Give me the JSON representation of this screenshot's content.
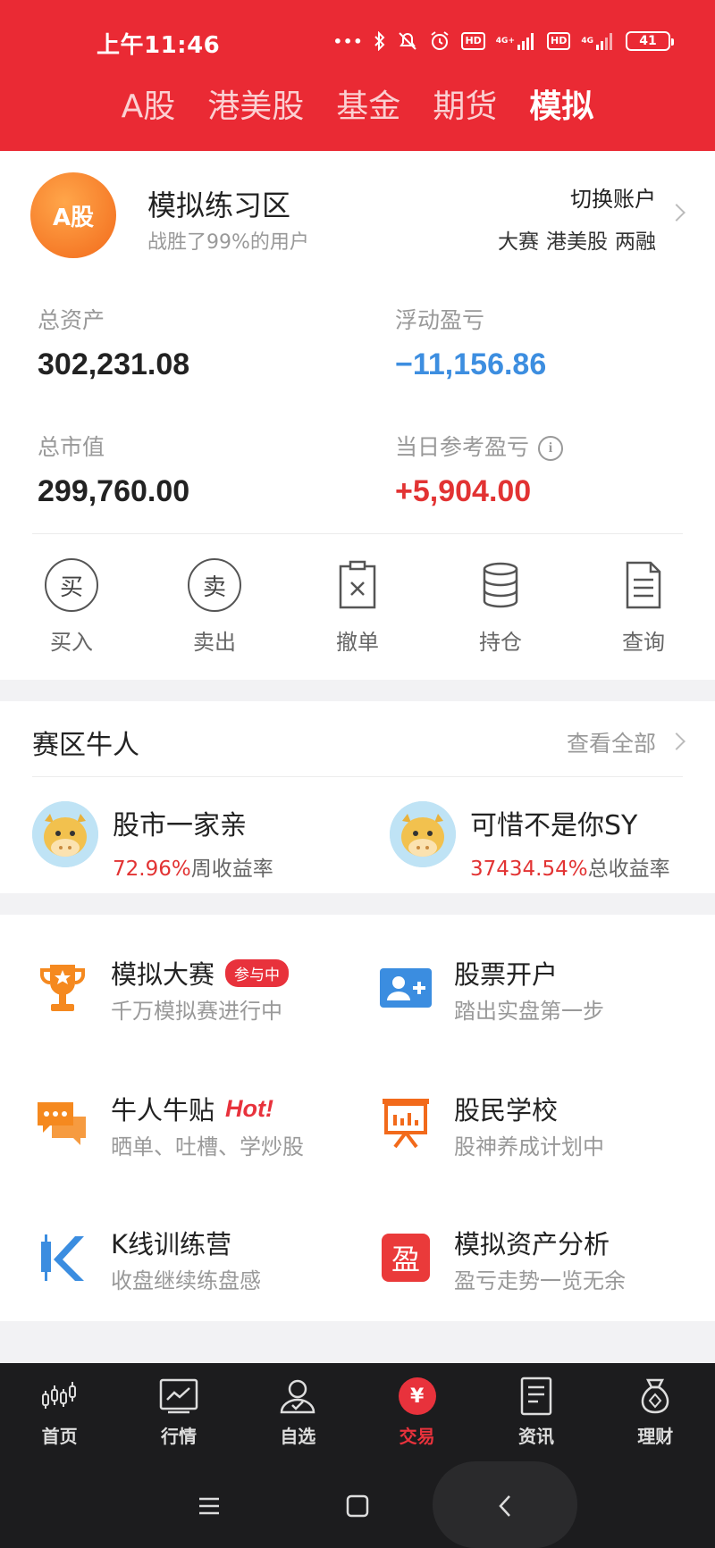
{
  "status_bar": {
    "time": "上午11:46",
    "battery": "41",
    "hd1": "HD",
    "hd2": "HD",
    "net1": "4G+",
    "net2": "4G"
  },
  "top_tabs": [
    {
      "label": "A股",
      "active": false
    },
    {
      "label": "港美股",
      "active": false
    },
    {
      "label": "基金",
      "active": false
    },
    {
      "label": "期货",
      "active": false
    },
    {
      "label": "模拟",
      "active": true
    }
  ],
  "account": {
    "avatar_text": "A股",
    "title": "模拟练习区",
    "subtitle": "战胜了99%的用户",
    "switch_label": "切换账户",
    "links": [
      "大赛",
      "港美股",
      "两融"
    ]
  },
  "metrics": {
    "total_assets_label": "总资产",
    "total_assets": "302,231.08",
    "floating_pl_label": "浮动盈亏",
    "floating_pl": "−11,156.86",
    "market_value_label": "总市值",
    "market_value": "299,760.00",
    "daily_pl_label": "当日参考盈亏",
    "daily_pl": "+5,904.00"
  },
  "actions": [
    {
      "label": "买入",
      "glyph": "买",
      "icon": "buy-icon"
    },
    {
      "label": "卖出",
      "glyph": "卖",
      "icon": "sell-icon"
    },
    {
      "label": "撤单",
      "icon": "cancel-order-icon"
    },
    {
      "label": "持仓",
      "icon": "holdings-icon"
    },
    {
      "label": "查询",
      "icon": "query-icon"
    }
  ],
  "niuren": {
    "title": "赛区牛人",
    "see_all": "查看全部",
    "users": [
      {
        "name": "股市一家亲",
        "pct": "72.96%",
        "suffix": "周收益率"
      },
      {
        "name": "可惜不是你SY",
        "pct": "37434.54%",
        "suffix": "总收益率"
      }
    ]
  },
  "features": [
    {
      "title": "模拟大赛",
      "badge": "参与中",
      "sub": "千万模拟赛进行中",
      "icon": "trophy-icon"
    },
    {
      "title": "股票开户",
      "sub": "踏出实盘第一步",
      "icon": "add-user-icon"
    },
    {
      "title": "牛人牛贴",
      "hot": "Hot!",
      "sub": "晒单、吐槽、学炒股",
      "icon": "chat-bubbles-icon"
    },
    {
      "title": "股民学校",
      "sub": "股神养成计划中",
      "icon": "presentation-board-icon"
    },
    {
      "title": "K线训练营",
      "sub": "收盘继续练盘感",
      "icon": "k-line-icon"
    },
    {
      "title": "模拟资产分析",
      "sub": "盈亏走势一览无余",
      "icon": "profit-analysis-icon",
      "glyph": "盈"
    }
  ],
  "bottom_nav": [
    {
      "label": "首页",
      "icon": "candlestick-home-icon",
      "active": false
    },
    {
      "label": "行情",
      "icon": "market-chart-icon",
      "active": false
    },
    {
      "label": "自选",
      "icon": "person-watchlist-icon",
      "active": false
    },
    {
      "label": "交易",
      "icon": "yen-trade-icon",
      "active": true,
      "glyph": "¥"
    },
    {
      "label": "资讯",
      "icon": "news-doc-icon",
      "active": false
    },
    {
      "label": "理财",
      "icon": "money-bag-icon",
      "active": false
    }
  ],
  "colors": {
    "brand_red": "#ea2a34",
    "up_red": "#e23333",
    "down_blue": "#3d8ee0",
    "orange": "#f5891f"
  }
}
